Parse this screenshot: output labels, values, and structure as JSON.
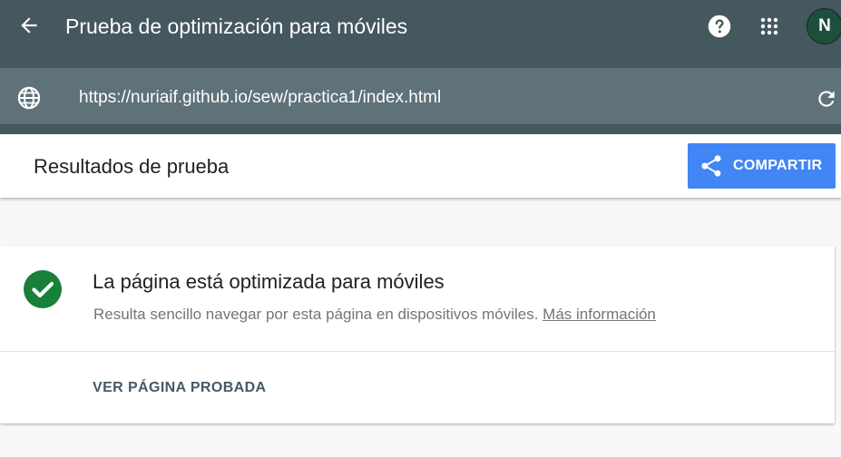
{
  "header": {
    "title": "Prueba de optimización para móviles",
    "back_icon": "arrow-left-icon",
    "help_icon": "help-circle-icon",
    "apps_icon": "apps-grid-icon",
    "avatar_initial": "N"
  },
  "url_bar": {
    "url": "https://nuriaif.github.io/sew/practica1/index.html",
    "globe_icon": "globe-icon",
    "reload_icon": "reload-icon"
  },
  "results_header": {
    "title": "Resultados de prueba",
    "share_label": "COMPARTIR",
    "share_icon": "share-icon"
  },
  "result_card": {
    "status_icon": "check-circle-icon",
    "title": "La página está optimizada para móviles",
    "description": "Resulta sencillo navegar por esta página en dispositivos móviles.",
    "more_info_link": "Más información",
    "view_page_label": "VER PÁGINA PROBADA"
  },
  "colors": {
    "topbar": "#45575f",
    "urlbar": "#5f7179",
    "share_button": "#4285f4",
    "success_green": "#188038",
    "avatar": "#1f4e3d"
  }
}
